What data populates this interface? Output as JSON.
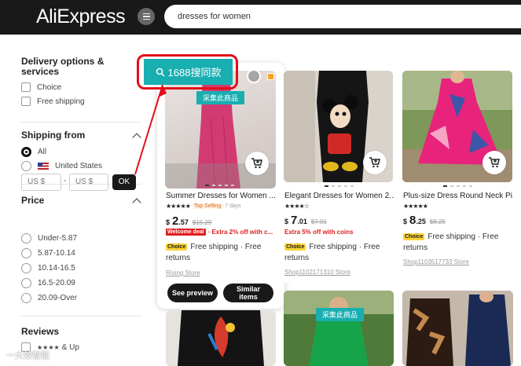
{
  "header": {
    "logo": "AliExpress",
    "search_value": "dresses for women"
  },
  "sidebar": {
    "delivery_title": "Delivery options & services",
    "delivery_options": [
      "Choice",
      "Free shipping"
    ],
    "shipping_title": "Shipping from",
    "shipping_options": [
      {
        "label": "All",
        "selected": true
      },
      {
        "label": "United States",
        "selected": false
      }
    ],
    "price_title": "Price",
    "price_min_placeholder": "US $",
    "price_max_placeholder": "US $",
    "price_dash": "-",
    "ok_label": "OK",
    "price_ranges": [
      "Under-5.87",
      "5.87-10.14",
      "10.14-16.5",
      "16.5-20.09",
      "20.09-Over"
    ],
    "reviews_title": "Reviews",
    "reviews_option": "& Up"
  },
  "plugin": {
    "button_label": "1688搜同款",
    "collect_label": "采集此商品"
  },
  "products": [
    {
      "title": "Summer Dresses for Women ...",
      "top_selling": "Top Selling",
      "sold_period": "7 days",
      "currency": "$",
      "price_int": "2",
      "price_dec": ".57",
      "price_old": "$15.29",
      "welcome_deal": "Welcome deal",
      "promo": "· Extra 2% off with c...",
      "choice": "Choice",
      "shipping": "Free shipping · Free returns",
      "store": "Rising Store",
      "preview_label": "See preview",
      "similar_label": "Similar items"
    },
    {
      "title": "Elegant Dresses for Women 2...",
      "currency": "$",
      "price_int": "7",
      "price_dec": ".01",
      "price_old": "$7.01",
      "promo": "Extra 5% off with coins",
      "choice": "Choice",
      "shipping": "Free shipping · Free returns",
      "store": "Shop1102171310 Store"
    },
    {
      "title": "Plus-size Dress Round Neck Pi...",
      "currency": "$",
      "price_int": "8",
      "price_dec": ".25",
      "price_old": "$8.25",
      "choice": "Choice",
      "shipping": "Free shipping · Free returns",
      "store": "Shop1103517733 Store"
    }
  ],
  "watermark": "一大效智能",
  "colors": {
    "header_bg": "#191919",
    "plugin_teal": "#19aeb0",
    "highlight_red": "#e0101a",
    "choice_yellow": "#fcd436",
    "promo_red": "#e02020"
  }
}
